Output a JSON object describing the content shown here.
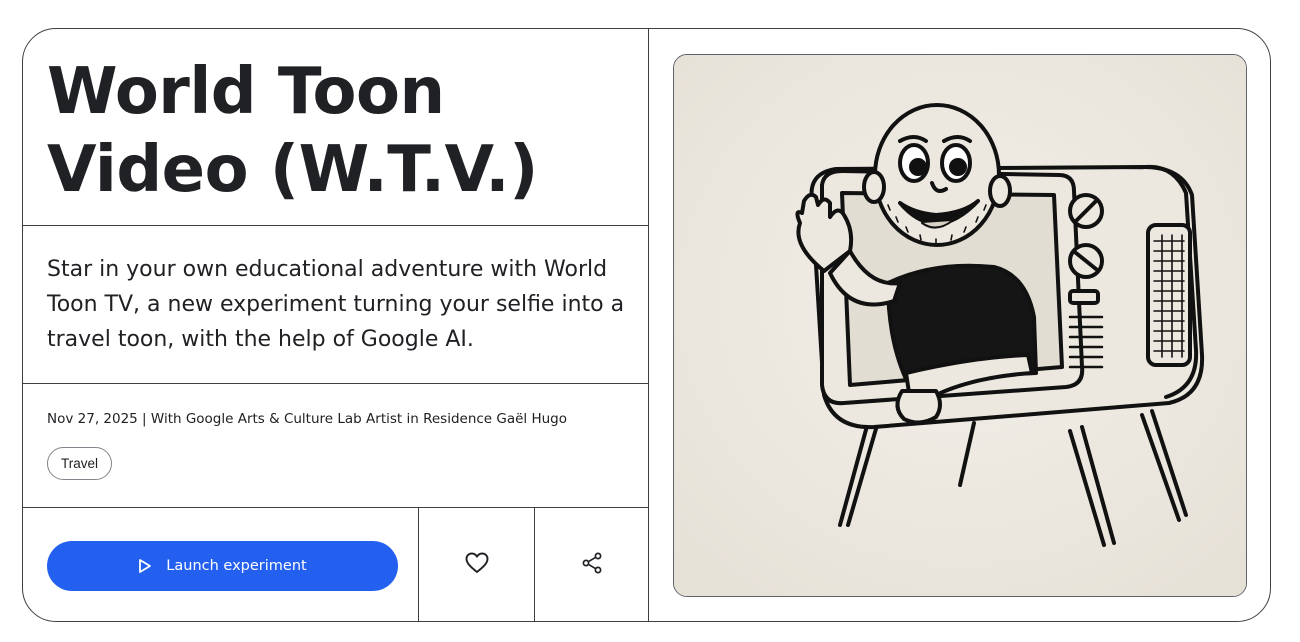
{
  "title": {
    "line1": "World Toon",
    "line2": "Video (W.T.V.)"
  },
  "description": "Star in your own educational adventure with World Toon TV, a new experiment turning your selfie into a travel toon, with the help of Google AI.",
  "meta": "Nov 27, 2025 | With Google Arts & Culture Lab Artist in Residence Gaël Hugo",
  "tag": "Travel",
  "actions": {
    "launch_label": "Launch experiment",
    "launch_icon": "play-icon",
    "like_icon": "heart-icon",
    "share_icon": "share-icon"
  },
  "colors": {
    "accent": "#2460f0",
    "border": "#3c4043",
    "text": "#202124",
    "illustration_bg": "#efebe3"
  }
}
